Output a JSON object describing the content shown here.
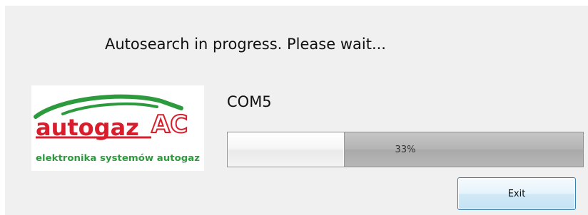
{
  "dialog": {
    "heading": "Autosearch in progress. Please wait...",
    "port": "COM5"
  },
  "logo": {
    "brand_main": "autogaz",
    "brand_suffix": "AC",
    "tagline": "elektronika systemów autogaz",
    "colors": {
      "red": "#d81e2c",
      "green": "#2e9a3e"
    }
  },
  "progress": {
    "value_percent": 33,
    "label": "33%"
  },
  "buttons": {
    "exit_label": "Exit"
  },
  "colors": {
    "dialog_background": "#f0f0f0",
    "button_border": "#3c7fb1"
  }
}
